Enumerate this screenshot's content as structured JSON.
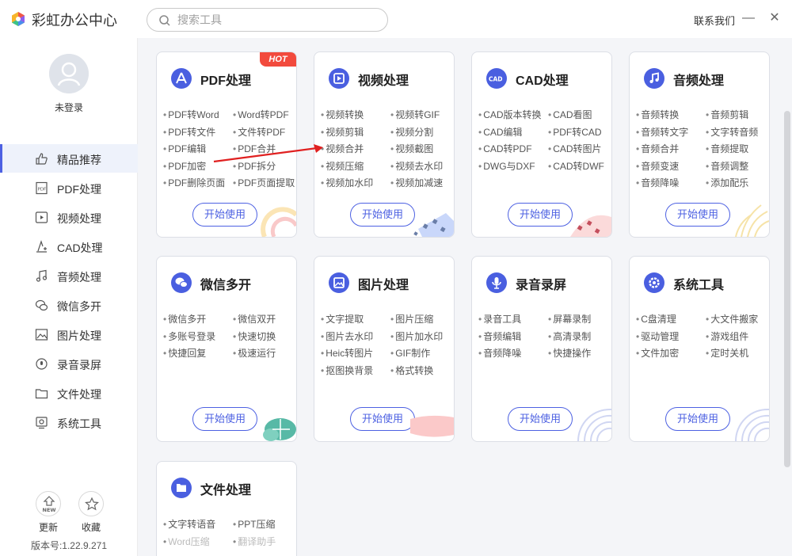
{
  "app": {
    "title": "彩虹办公中心",
    "contact": "联系我们"
  },
  "search": {
    "placeholder": "搜索工具"
  },
  "window": {
    "minimize": "—",
    "close": "✕"
  },
  "user": {
    "status": "未登录"
  },
  "sidebar": {
    "items": [
      {
        "label": "精品推荐",
        "icon": "thumbs-up-icon",
        "active": true
      },
      {
        "label": "PDF处理",
        "icon": "pdf-icon"
      },
      {
        "label": "视频处理",
        "icon": "video-icon"
      },
      {
        "label": "CAD处理",
        "icon": "cad-icon"
      },
      {
        "label": "音频处理",
        "icon": "music-icon"
      },
      {
        "label": "微信多开",
        "icon": "wechat-icon"
      },
      {
        "label": "图片处理",
        "icon": "image-icon"
      },
      {
        "label": "录音录屏",
        "icon": "record-icon"
      },
      {
        "label": "文件处理",
        "icon": "folder-icon"
      },
      {
        "label": "系统工具",
        "icon": "system-icon"
      }
    ],
    "bottom": {
      "update": "更新",
      "update_badge": "NEW",
      "favorite": "收藏"
    },
    "version": "版本号:1.22.9.271"
  },
  "cards": [
    {
      "title": "PDF处理",
      "hot": "HOT",
      "icon": "pdf-icon",
      "features": [
        "PDF转Word",
        "Word转PDF",
        "PDF转文件",
        "文件转PDF",
        "PDF编辑",
        "PDF合并",
        "PDF加密",
        "PDF拆分",
        "PDF删除页面",
        "PDF页面提取"
      ]
    },
    {
      "title": "视频处理",
      "icon": "play-icon",
      "features": [
        "视频转换",
        "视频转GIF",
        "视频剪辑",
        "视频分割",
        "视频合并",
        "视频截图",
        "视频压缩",
        "视频去水印",
        "视频加水印",
        "视频加减速"
      ]
    },
    {
      "title": "CAD处理",
      "icon": "cad-icon",
      "icon_text": "CAD",
      "features": [
        "CAD版本转换",
        "CAD看图",
        "CAD编辑",
        "PDF转CAD",
        "CAD转PDF",
        "CAD转图片",
        "DWG与DXF",
        "CAD转DWF"
      ]
    },
    {
      "title": "音频处理",
      "icon": "music-icon",
      "features": [
        "音频转换",
        "音频剪辑",
        "音频转文字",
        "文字转音频",
        "音频合并",
        "音频提取",
        "音频变速",
        "音频调整",
        "音频降噪",
        "添加配乐"
      ]
    },
    {
      "title": "微信多开",
      "icon": "wechat-icon",
      "features": [
        "微信多开",
        "微信双开",
        "多账号登录",
        "快速切换",
        "快捷回复",
        "极速运行"
      ]
    },
    {
      "title": "图片处理",
      "icon": "image-icon",
      "features": [
        "文字提取",
        "图片压缩",
        "图片去水印",
        "图片加水印",
        "Heic转图片",
        "GIF制作",
        "抠图换背景",
        "格式转换"
      ]
    },
    {
      "title": "录音录屏",
      "icon": "microphone-icon",
      "features": [
        "录音工具",
        "屏幕录制",
        "音频编辑",
        "高清录制",
        "音频降噪",
        "快捷操作"
      ]
    },
    {
      "title": "系统工具",
      "icon": "gear-icon",
      "features": [
        "C盘清理",
        "大文件搬家",
        "驱动管理",
        "游戏组件",
        "文件加密",
        "定时关机"
      ]
    },
    {
      "title": "文件处理",
      "icon": "folder-icon",
      "features": [
        "文字转语音",
        "PPT压缩",
        "Word压缩",
        "翻译助手"
      ]
    }
  ],
  "start_label": "开始使用",
  "colors": {
    "accent": "#4d61e2",
    "hot": "#f24a3d",
    "arrow": "#e02020"
  }
}
